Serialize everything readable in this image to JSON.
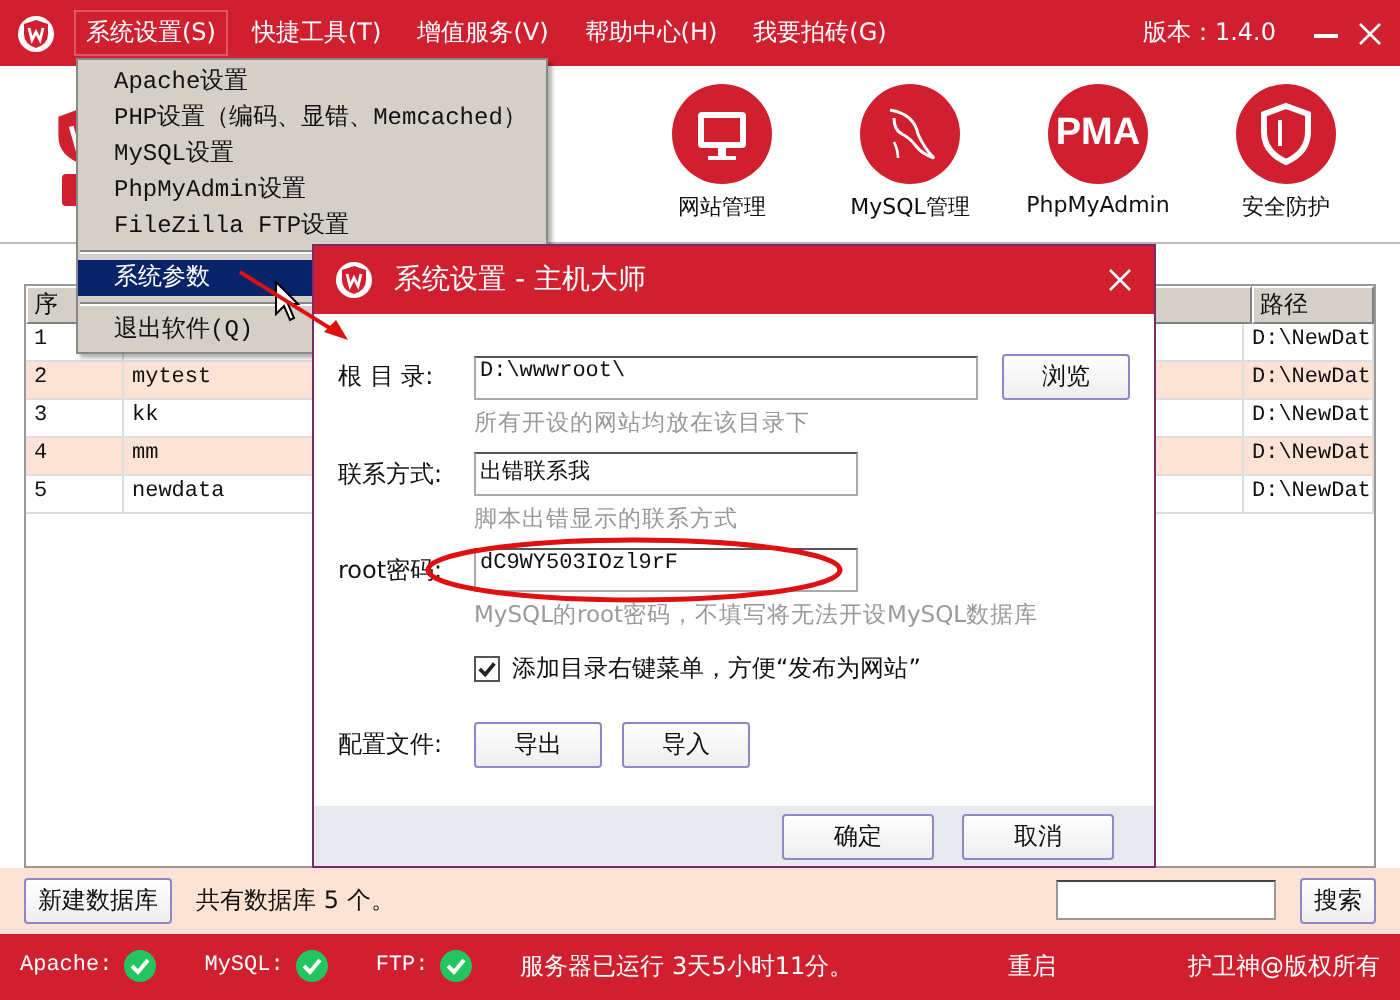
{
  "window": {
    "menu": [
      {
        "label": "系统设置(S)",
        "selected": true
      },
      {
        "label": "快捷工具(T)",
        "selected": false
      },
      {
        "label": "增值服务(V)",
        "selected": false
      },
      {
        "label": "帮助中心(H)",
        "selected": false
      },
      {
        "label": "我要拍砖(G)",
        "selected": false
      }
    ],
    "version": "版本：1.4.0"
  },
  "toolbar": [
    {
      "label": "网站管理",
      "kind": "monitor"
    },
    {
      "label": "MySQL管理",
      "kind": "dolphin"
    },
    {
      "label": "PhpMyAdmin",
      "kind": "pma",
      "icon_text": "PMA"
    },
    {
      "label": "安全防护",
      "kind": "shield"
    }
  ],
  "dropdown": {
    "groups": [
      [
        {
          "label": "Apache设置",
          "selected": false
        },
        {
          "label": "PHP设置（编码、显错、Memcached）",
          "selected": false
        },
        {
          "label": "MySQL设置",
          "selected": false
        },
        {
          "label": "PhpMyAdmin设置",
          "selected": false
        },
        {
          "label": "FileZilla FTP设置",
          "selected": false
        }
      ],
      [
        {
          "label": "系统参数",
          "selected": true
        }
      ],
      [
        {
          "label": "退出软件(Q)",
          "selected": false
        }
      ]
    ]
  },
  "table": {
    "columns": [
      "序",
      "路径"
    ],
    "rows": [
      {
        "index": "1",
        "path": "D:\\NewDat"
      },
      {
        "index": "2",
        "name": "mytest",
        "path": "D:\\NewDat"
      },
      {
        "index": "3",
        "name": "kk",
        "path": "D:\\NewDat"
      },
      {
        "index": "4",
        "name": "mm",
        "path": "D:\\NewDat"
      },
      {
        "index": "5",
        "name": "newdata",
        "path": "D:\\NewDat"
      }
    ]
  },
  "footer": {
    "new_button": "新建数据库",
    "count": "共有数据库 5 个。",
    "search_button": "搜索"
  },
  "status_bar": {
    "services": [
      {
        "name": "Apache:",
        "ok": true
      },
      {
        "name": "MySQL:",
        "ok": true
      },
      {
        "name": "FTP:",
        "ok": true
      }
    ],
    "uptime": "服务器已运行 3天5小时11分。",
    "restart": "重启",
    "copyright": "护卫神@版权所有"
  },
  "dialog": {
    "title": "系统设置 - 主机大师",
    "fields": [
      {
        "label": "根 目 录:",
        "value": "D:\\wwwroot\\",
        "hint": "所有开设的网站均放在该目录下",
        "button": "浏览"
      },
      {
        "label": "联系方式:",
        "value": "出错联系我",
        "hint": "脚本出错显示的联系方式"
      },
      {
        "label": "root密码:",
        "value": "dC9WY503IOzl9rF",
        "hint": "MySQL的root密码，不填写将无法开设MySQL数据库"
      }
    ],
    "checkbox": {
      "label": "添加目录右键菜单，方便“发布为网站”",
      "checked": true
    },
    "config": {
      "label": "配置文件:",
      "buttons": [
        "导出",
        "导入"
      ]
    },
    "buttons": [
      "确定",
      "取消"
    ]
  }
}
